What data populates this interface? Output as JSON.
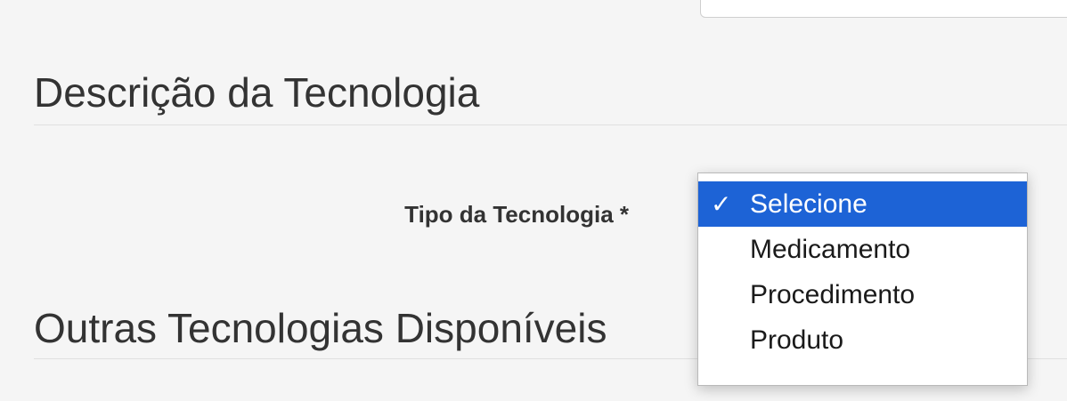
{
  "sections": [
    {
      "title": "Descrição da Tecnologia"
    },
    {
      "title": "Outras Tecnologias Disponíveis"
    }
  ],
  "tipo_field": {
    "label": "Tipo da Tecnologia *",
    "selected_value": "Selecione",
    "checkmark": "✓",
    "options": [
      {
        "label": "Selecione",
        "selected": true
      },
      {
        "label": "Medicamento",
        "selected": false
      },
      {
        "label": "Procedimento",
        "selected": false
      },
      {
        "label": "Produto",
        "selected": false
      }
    ]
  },
  "colors": {
    "background": "#f5f5f5",
    "selected_option_bg": "#1d63d6",
    "title_text": "#333333"
  }
}
